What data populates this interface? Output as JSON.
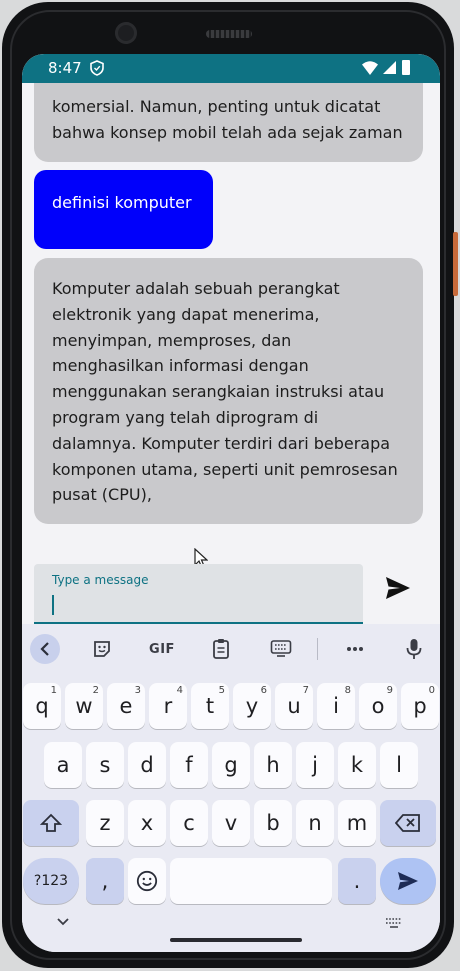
{
  "status_bar": {
    "time": "8:47"
  },
  "chat": {
    "previous_bot_text": "komersial. Namun, penting untuk dicatat bahwa konsep mobil telah ada sejak zaman",
    "user_message": "definisi komputer",
    "bot_answer": "Komputer adalah sebuah perangkat elektronik yang dapat menerima, menyimpan, memproses, dan menghasilkan informasi dengan menggunakan serangkaian instruksi atau program yang telah diprogram di dalamnya. Komputer terdiri dari beberapa komponen utama, seperti unit pemrosesan pusat (CPU),",
    "colors": {
      "user_bubble": "#0000fb",
      "bot_bubble": "#c9c9cc",
      "accent": "#0e7283"
    }
  },
  "composer": {
    "label": "Type a message",
    "value": "",
    "send_icon": "send-icon"
  },
  "keyboard": {
    "toolbar": {
      "gif": "GIF"
    },
    "row1": [
      {
        "k": "q",
        "n": "1"
      },
      {
        "k": "w",
        "n": "2"
      },
      {
        "k": "e",
        "n": "3"
      },
      {
        "k": "r",
        "n": "4"
      },
      {
        "k": "t",
        "n": "5"
      },
      {
        "k": "y",
        "n": "6"
      },
      {
        "k": "u",
        "n": "7"
      },
      {
        "k": "i",
        "n": "8"
      },
      {
        "k": "o",
        "n": "9"
      },
      {
        "k": "p",
        "n": "0"
      }
    ],
    "row2": [
      "a",
      "s",
      "d",
      "f",
      "g",
      "h",
      "j",
      "k",
      "l"
    ],
    "row3": [
      "z",
      "x",
      "c",
      "v",
      "b",
      "n",
      "m"
    ],
    "symbols_key": "?123",
    "comma_key": ",",
    "period_key": "."
  }
}
